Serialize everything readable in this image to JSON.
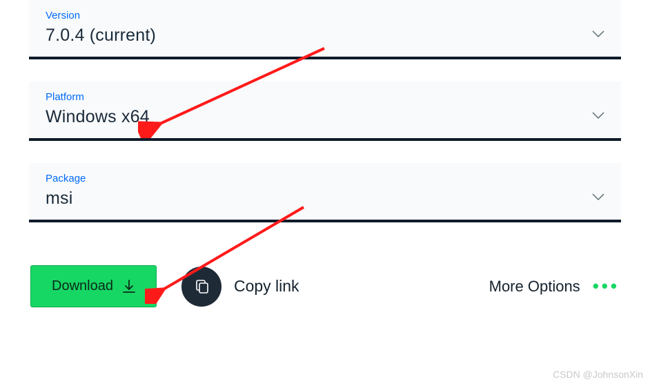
{
  "selectors": {
    "version": {
      "label": "Version",
      "value": "7.0.4 (current)"
    },
    "platform": {
      "label": "Platform",
      "value": "Windows x64"
    },
    "package": {
      "label": "Package",
      "value": "msi"
    }
  },
  "actions": {
    "download_label": "Download",
    "copy_label": "Copy link",
    "more_label": "More Options"
  },
  "watermark": "CSDN @JohnsonXin",
  "colors": {
    "accent_blue": "#016bf8",
    "accent_green": "#17d764",
    "divider": "#0f1b2a"
  }
}
